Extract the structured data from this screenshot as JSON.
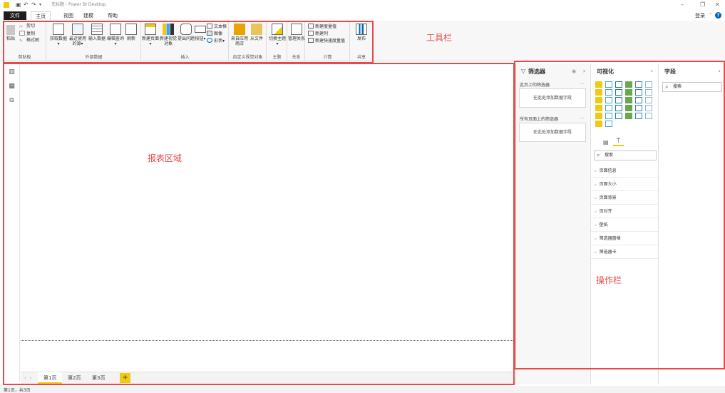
{
  "window": {
    "title": "无标题 - Power BI Desktop",
    "login": "登录"
  },
  "menu_tabs": [
    "文件",
    "主页",
    "视图",
    "建模",
    "帮助"
  ],
  "ribbon": {
    "groups": {
      "clipboard": {
        "label": "剪贴板",
        "paste": "粘贴",
        "cut": "剪切",
        "copy": "复制",
        "format_painter": "格式刷"
      },
      "external_data": {
        "label": "外部数据",
        "get_data": "获取数据▾",
        "recent_sources": "最近使用的源▾",
        "enter_data": "输入数据",
        "edit_queries": "编辑查询▾",
        "refresh": "刷新"
      },
      "insert": {
        "label": "插入",
        "new_page": "新建页面▾",
        "new_visual": "新建视觉对象",
        "ask_question": "提出问题",
        "buttons": "按钮▾",
        "text_box": "文本框",
        "image": "图像",
        "shapes": "形状▾"
      },
      "custom_visuals": {
        "label": "自定义视觉对象",
        "from_marketplace": "来自应用商店",
        "from_file": "从文件"
      },
      "themes": {
        "label": "主题",
        "switch_theme": "切换主题▾"
      },
      "relationships": {
        "label": "关系",
        "manage": "管理关系"
      },
      "calculations": {
        "label": "计算",
        "new_measure": "新建度量值",
        "new_column": "新建列",
        "new_quick_measure": "新建快速度量值"
      },
      "share": {
        "label": "共享",
        "publish": "发布"
      }
    }
  },
  "annotations": {
    "toolbar": "工具栏",
    "report_area": "报表区域",
    "operations": "操作栏"
  },
  "pages": [
    "第1页",
    "第2页",
    "第3页"
  ],
  "add_page": "+",
  "status": "第1页，共3页",
  "filters_pane": {
    "title": "筛选器",
    "this_page": "此页上的筛选器",
    "all_pages": "所有页面上的筛选器",
    "drop_hint": "在此处添加数据字段",
    "more": "..."
  },
  "viz_pane": {
    "title": "可视化",
    "search_placeholder": "搜索",
    "format_items": [
      "页面信息",
      "页面大小",
      "页面背景",
      "页对齐",
      "壁纸",
      "筛选器窗格",
      "筛选器卡"
    ]
  },
  "fields_pane": {
    "title": "字段",
    "search_placeholder": "搜索"
  },
  "colors": {
    "annotation": "#e84a4a",
    "accent_yellow": "#f2c811",
    "file_tab": "#1e1e1e"
  }
}
